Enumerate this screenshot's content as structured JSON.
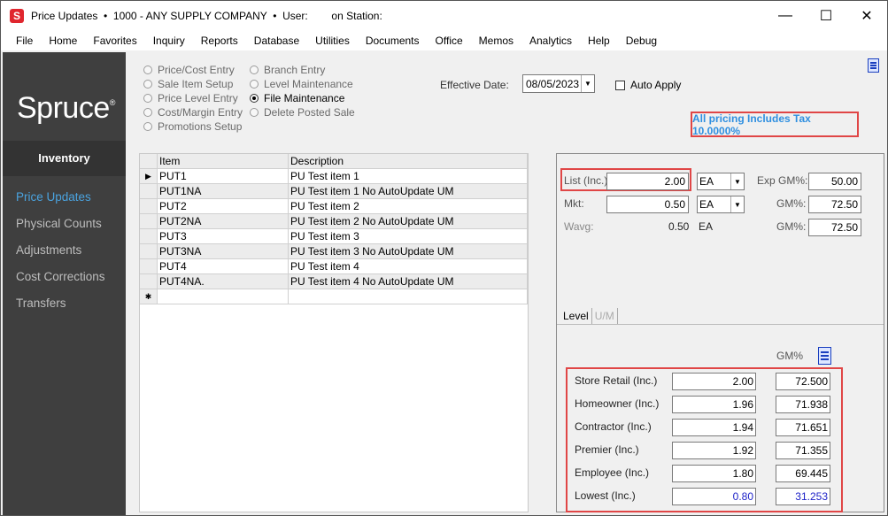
{
  "window": {
    "icon_letter": "S",
    "title": "Price Updates  •  1000 - ANY SUPPLY COMPANY  •  User:        on Station:",
    "minimize": "—",
    "maximize": "☐",
    "close": "✕"
  },
  "menu": [
    "File",
    "Home",
    "Favorites",
    "Inquiry",
    "Reports",
    "Database",
    "Utilities",
    "Documents",
    "Office",
    "Memos",
    "Analytics",
    "Help",
    "Debug"
  ],
  "sidebar": {
    "logo": "Spruce",
    "logo_mark": "®",
    "section": "Inventory",
    "items": [
      "Price Updates",
      "Physical Counts",
      "Adjustments",
      "Cost Corrections",
      "Transfers"
    ],
    "active_index": 0
  },
  "modes": {
    "col1": [
      "Price/Cost Entry",
      "Sale Item Setup",
      "Price Level Entry",
      "Cost/Margin Entry",
      "Promotions Setup"
    ],
    "col2": [
      "Branch Entry",
      "Level Maintenance",
      "File Maintenance",
      "Delete Posted Sale"
    ],
    "selected": "File Maintenance"
  },
  "effective_date": {
    "label": "Effective Date:",
    "value": "08/05/2023"
  },
  "auto_apply": {
    "label": "Auto Apply",
    "checked": false
  },
  "tax_note": "All pricing Includes Tax 10.0000%",
  "grid": {
    "headers": {
      "item": "Item",
      "description": "Description"
    },
    "rows": [
      {
        "item": "PUT1",
        "description": "PU Test item 1"
      },
      {
        "item": "PUT1NA",
        "description": "PU Test item 1 No AutoUpdate UM"
      },
      {
        "item": "PUT2",
        "description": "PU Test item 2"
      },
      {
        "item": "PUT2NA",
        "description": "PU Test item 2 No AutoUpdate UM"
      },
      {
        "item": "PUT3",
        "description": "PU Test item 3"
      },
      {
        "item": "PUT3NA",
        "description": "PU Test item 3 No AutoUpdate UM"
      },
      {
        "item": "PUT4",
        "description": "PU Test item 4"
      },
      {
        "item": "PUT4NA.",
        "description": "PU Test item 4 No AutoUpdate UM"
      }
    ],
    "current_marker": "▶",
    "new_row_marker": "✱"
  },
  "pricing": {
    "list": {
      "label": "List (Inc.)",
      "value": "2.00",
      "uom": "EA"
    },
    "mkt": {
      "label": "Mkt:",
      "value": "0.50",
      "uom": "EA"
    },
    "wavg": {
      "label": "Wavg:",
      "value": "0.50",
      "uom": "EA"
    },
    "exp_gm": {
      "label": "Exp GM%:",
      "value": "50.00"
    },
    "gm1": {
      "label": "GM%:",
      "value": "72.50"
    },
    "gm2": {
      "label": "GM%:",
      "value": "72.50"
    }
  },
  "tabs": [
    "Level",
    "U/M"
  ],
  "levels": {
    "gm_header": "GM%",
    "rows": [
      {
        "label": "Store Retail (Inc.)",
        "value": "2.00",
        "gm": "72.500"
      },
      {
        "label": "Homeowner (Inc.)",
        "value": "1.96",
        "gm": "71.938"
      },
      {
        "label": "Contractor (Inc.)",
        "value": "1.94",
        "gm": "71.651"
      },
      {
        "label": "Premier (Inc.)",
        "value": "1.92",
        "gm": "71.355"
      },
      {
        "label": "Employee (Inc.)",
        "value": "1.80",
        "gm": "69.445"
      },
      {
        "label": "Lowest (Inc.)",
        "value": "0.80",
        "gm": "31.253"
      }
    ]
  },
  "colors": {
    "accent": "#4aa3df",
    "highlight_border": "#e04646",
    "tax_text": "#2f8fe0",
    "lowest_text": "#1e22c8",
    "sidebar_bg": "#3f3f3f"
  }
}
